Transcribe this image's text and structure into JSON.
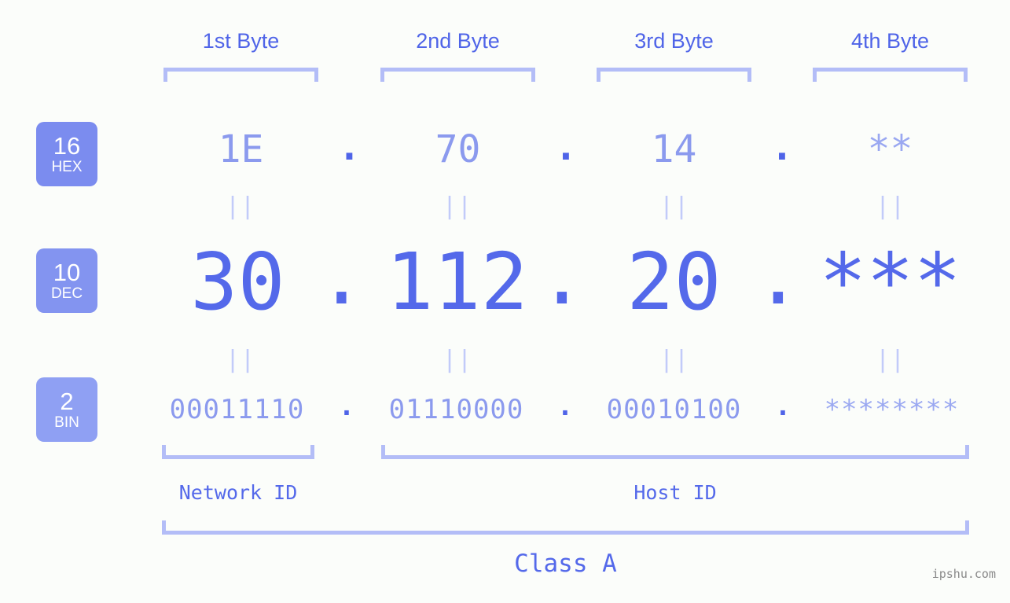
{
  "theme": {
    "background": "#fbfdfa",
    "accent_strong": "#4f64e8",
    "accent_mid": "#5469ea",
    "accent_light": "#8b9aee",
    "bracket": "#b3bdf7",
    "badge_hex_bg": "#7b8cef",
    "badge_dec_bg": "#8394f0",
    "badge_bin_bg": "#8fa0f3",
    "separator": "#c2cbf9",
    "watermark": "#8a8a8a"
  },
  "byte_headers": [
    {
      "label": "1st Byte"
    },
    {
      "label": "2nd Byte"
    },
    {
      "label": "3rd Byte"
    },
    {
      "label": "4th Byte"
    }
  ],
  "bases": [
    {
      "number": "16",
      "name": "HEX"
    },
    {
      "number": "10",
      "name": "DEC"
    },
    {
      "number": "2",
      "name": "BIN"
    }
  ],
  "rows": {
    "hex": {
      "base_number": "16",
      "base_name": "HEX",
      "values": [
        "1E",
        "70",
        "14",
        "**"
      ],
      "separator": "."
    },
    "dec": {
      "base_number": "10",
      "base_name": "DEC",
      "values": [
        "30",
        "112",
        "20",
        "***"
      ],
      "separator": "."
    },
    "bin": {
      "base_number": "2",
      "base_name": "BIN",
      "values": [
        "00011110",
        "01110000",
        "00010100",
        "********"
      ],
      "separator": "."
    }
  },
  "equals_marks": [
    "||",
    "||",
    "||",
    "||",
    "||",
    "||",
    "||",
    "||"
  ],
  "sections": {
    "network_id": "Network ID",
    "host_id": "Host ID",
    "class": "Class A"
  },
  "watermark": "ipshu.com"
}
